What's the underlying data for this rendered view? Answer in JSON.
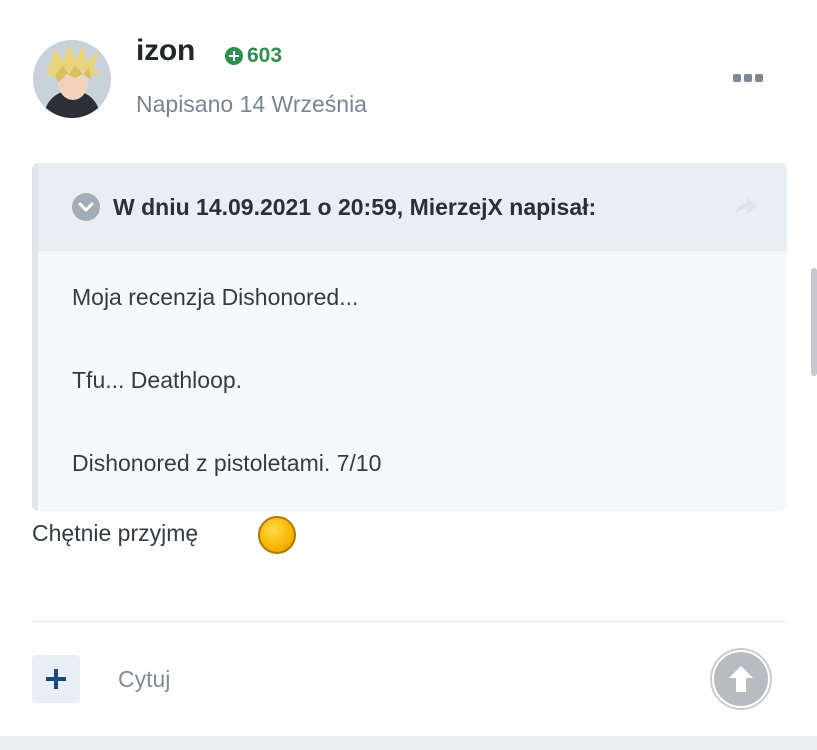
{
  "post": {
    "author": "izon",
    "reputation": "603",
    "date": "Napisano 14 Września",
    "quote": {
      "header": "W dniu 14.09.2021 o 20:59, MierzejX napisał:",
      "lines": [
        "Moja recenzja Dishonored...",
        "Tfu... Deathloop.",
        "Dishonored z pistoletami. 7/10"
      ]
    },
    "reply_text": "Chętnie przyjmę"
  },
  "actions": {
    "quote_label": "Cytuj"
  },
  "colors": {
    "reputation": "#2f8f4e",
    "quote_bg": "#f6f9fb",
    "quote_header_bg": "#e9eef3",
    "add_button_icon": "#1c4a78"
  },
  "icons": {
    "reputation": "plus-circle-icon",
    "menu": "more-dots-icon",
    "quote_toggle": "chevron-down-icon",
    "share": "share-arrow-icon",
    "emoji": "gold-coin-emoji",
    "add": "plus-icon",
    "scroll_top": "arrow-up-icon"
  }
}
